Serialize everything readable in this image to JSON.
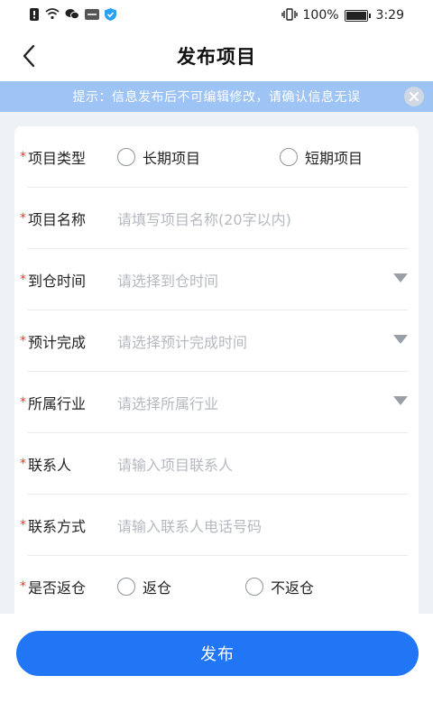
{
  "status_bar": {
    "battery": "100%",
    "time": "3:29"
  },
  "nav": {
    "title": "发布项目"
  },
  "notice": {
    "text": "提示：信息发布后不可编辑修改，请确认信息无误"
  },
  "form": {
    "required_mark": "*",
    "project_type": {
      "label": "项目类型",
      "option1": "长期项目",
      "option2": "短期项目"
    },
    "project_name": {
      "label": "项目名称",
      "placeholder": "请填写项目名称(20字以内)"
    },
    "arrival_time": {
      "label": "到仓时间",
      "placeholder": "请选择到仓时间"
    },
    "expected_completion": {
      "label": "预计完成",
      "placeholder": "请选择预计完成时间"
    },
    "industry": {
      "label": "所属行业",
      "placeholder": "请选择所属行业"
    },
    "contact_person": {
      "label": "联系人",
      "placeholder": "请输入项目联系人"
    },
    "contact_method": {
      "label": "联系方式",
      "placeholder": "请输入联系人电话号码"
    },
    "return_warehouse": {
      "label": "是否返仓",
      "option1": "返仓",
      "option2": "不返仓"
    }
  },
  "submit": {
    "label": "发布"
  },
  "colors": {
    "primary": "#2076f5",
    "notice_bg": "#9ec3f5",
    "required": "#e6362f",
    "placeholder": "#b5b9c0",
    "page_bg": "#eef1f6"
  }
}
